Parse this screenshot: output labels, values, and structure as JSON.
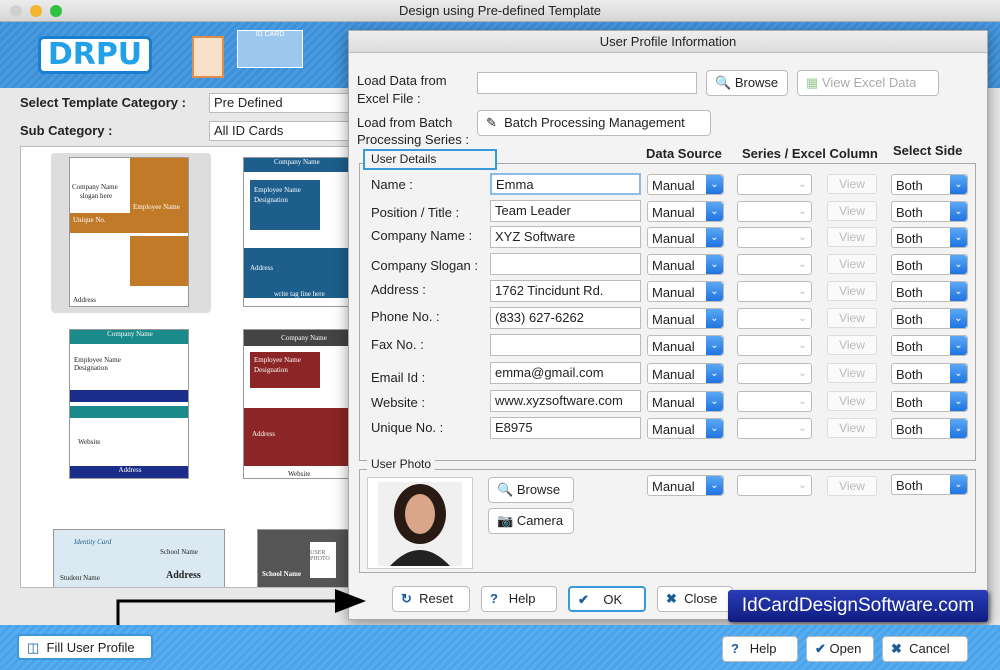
{
  "window": {
    "title": "Design using Pre-defined Template"
  },
  "header": {
    "logo": "DRPU",
    "id_card_label": "ID CARD"
  },
  "left": {
    "category_label": "Select Template Category :",
    "category_value": "Pre Defined",
    "subcategory_label": "Sub Category :",
    "subcategory_value": "All ID Cards"
  },
  "templates": [
    {
      "t1": "Company Name",
      "t2": "slogan here",
      "t3": "Employee Name",
      "t4": "Unique No.",
      "t5": "Address"
    },
    {
      "t1": "Company Name",
      "t2": "Employee Name",
      "t3": "Designation",
      "t4": "Address",
      "t5": "write tag line here"
    },
    {
      "t1": "Company Name",
      "t2": "Employee Name",
      "t3": "Designation",
      "t4": "Website",
      "t5": "Address"
    },
    {
      "t1": "Company Name",
      "t2": "Employee Name",
      "t3": "Designation",
      "t4": "Address",
      "t5": "Website"
    },
    {
      "t1": "Identity Card",
      "t2": "School Name",
      "t3": "Student Name",
      "t4": "Address",
      "t5": ""
    },
    {
      "t1": "School Name",
      "t2": "USER PHOTO",
      "t3": "",
      "t4": "",
      "t5": ""
    }
  ],
  "dialog": {
    "title": "User Profile Information",
    "excel_label_1": "Load Data from",
    "excel_label_2": "Excel File :",
    "excel_value": "",
    "browse": "Browse",
    "view_excel": "View Excel Data",
    "batch_label_1": "Load from Batch",
    "batch_label_2": "Processing Series :",
    "batch_button": "Batch Processing Management",
    "group_user_details": "User Details",
    "col_data_source": "Data Source",
    "col_series": "Series / Excel Column",
    "col_side": "Select Side",
    "fields": [
      {
        "label": "Name :",
        "value": "Emma",
        "source": "Manual",
        "side": "Both"
      },
      {
        "label": "Position / Title :",
        "value": "Team Leader",
        "source": "Manual",
        "side": "Both"
      },
      {
        "label": "Company Name :",
        "value": "XYZ Software",
        "source": "Manual",
        "side": "Both"
      },
      {
        "label": "Company Slogan :",
        "value": "",
        "source": "Manual",
        "side": "Both"
      },
      {
        "label": "Address :",
        "value": "1762 Tincidunt Rd.",
        "source": "Manual",
        "side": "Both"
      },
      {
        "label": "Phone No. :",
        "value": "(833) 627-6262",
        "source": "Manual",
        "side": "Both"
      },
      {
        "label": "Fax No. :",
        "value": "",
        "source": "Manual",
        "side": "Both"
      },
      {
        "label": "Email Id :",
        "value": "emma@gmail.com",
        "source": "Manual",
        "side": "Both"
      },
      {
        "label": "Website :",
        "value": "www.xyzsoftware.com",
        "source": "Manual",
        "side": "Both"
      },
      {
        "label": "Unique No. :",
        "value": "E8975",
        "source": "Manual",
        "side": "Both"
      }
    ],
    "view_label": "View",
    "group_user_photo": "User Photo",
    "photo_browse": "Browse",
    "photo_camera": "Camera",
    "photo_source": "Manual",
    "photo_side": "Both",
    "reset": "Reset",
    "help": "Help",
    "ok": "OK",
    "close": "Close"
  },
  "watermark": "IdCardDesignSoftware.com",
  "footer": {
    "fill_profile": "Fill User Profile",
    "help": "Help",
    "open": "Open",
    "cancel": "Cancel"
  },
  "colors": {
    "accent": "#1f74e0",
    "header_blue": "#3d8fd6",
    "orange_template": "#c07a28"
  }
}
